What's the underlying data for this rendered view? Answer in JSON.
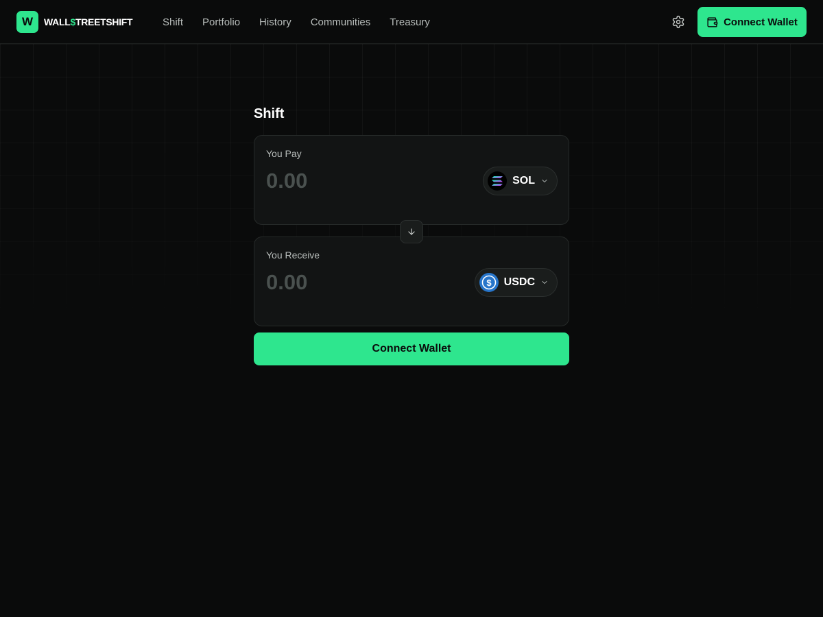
{
  "brand": {
    "badge_letter": "W",
    "name_part1": "WALL",
    "name_dollar": "$",
    "name_part2": "TREETSHIFT",
    "accent_color": "#2ee68e"
  },
  "nav": {
    "items": [
      {
        "label": "Shift"
      },
      {
        "label": "Portfolio"
      },
      {
        "label": "History"
      },
      {
        "label": "Communities"
      },
      {
        "label": "Treasury"
      }
    ]
  },
  "header": {
    "settings_icon": "gear-icon",
    "connect_label": "Connect Wallet",
    "connect_icon": "wallet-icon"
  },
  "main": {
    "title": "Shift",
    "pay": {
      "label": "You Pay",
      "value": "",
      "placeholder": "0.00",
      "token": "SOL",
      "token_icon": "solana-icon"
    },
    "swap_icon": "arrow-down-icon",
    "receive": {
      "label": "You Receive",
      "value": "",
      "placeholder": "0.00",
      "token": "USDC",
      "token_icon": "usdc-icon"
    },
    "connect_label": "Connect Wallet"
  }
}
